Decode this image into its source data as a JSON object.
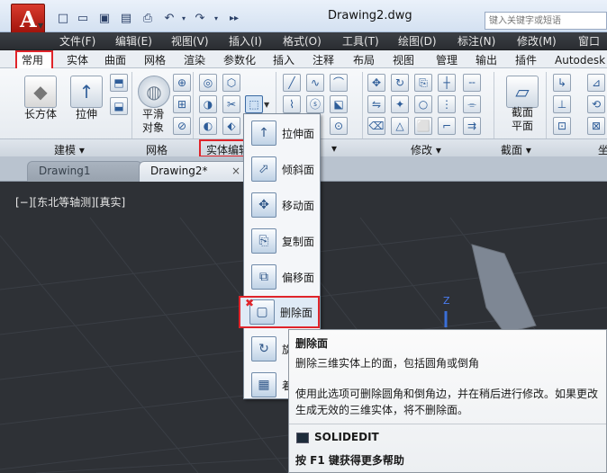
{
  "app": {
    "title": "Drawing2.dwg",
    "logo_letter": "A",
    "search_placeholder": "键入关键字或短语"
  },
  "quick_access": [
    "new-icon",
    "open-icon",
    "save-icon",
    "saveas-icon",
    "print-icon",
    "undo-icon",
    "redo-icon",
    "more-icon"
  ],
  "menu": [
    "文件(F)",
    "编辑(E)",
    "视图(V)",
    "插入(I)",
    "格式(O)",
    "工具(T)",
    "绘图(D)",
    "标注(N)",
    "修改(M)",
    "窗口"
  ],
  "tabs": [
    "常用",
    "实体",
    "曲面",
    "网格",
    "渲染",
    "参数化",
    "插入",
    "注释",
    "布局",
    "视图",
    "管理",
    "输出",
    "插件",
    "Autodesk"
  ],
  "ribbon": {
    "box_label": "长方体",
    "extrude_label": "拉伸",
    "smooth_label": "平滑\n对象",
    "section_label": "截面\n平面",
    "panels": [
      "建模 ▾",
      "网格",
      "实体编辑",
      "▾",
      "修改 ▾",
      "截面 ▾",
      "坐"
    ]
  },
  "doc_tabs": [
    "Drawing1",
    "Drawing2*"
  ],
  "doc_tab_close": "×",
  "viewport_label": "[−][东北等轴测][真实]",
  "axis_label": "Z",
  "dropdown": [
    {
      "label": "拉伸面",
      "icon": "extrude-face-icon"
    },
    {
      "label": "倾斜面",
      "icon": "taper-face-icon"
    },
    {
      "label": "移动面",
      "icon": "move-face-icon"
    },
    {
      "label": "复制面",
      "icon": "copy-face-icon"
    },
    {
      "label": "偏移面",
      "icon": "offset-face-icon"
    },
    {
      "label": "删除面",
      "icon": "delete-face-icon"
    },
    {
      "label": "旋",
      "icon": "rotate-face-icon"
    },
    {
      "label": "着",
      "icon": "color-face-icon"
    }
  ],
  "tooltip": {
    "title": "删除面",
    "desc": "删除三维实体上的面，包括圆角或倒角",
    "detail1": "使用此选项可删除圆角和倒角边，并在稍后进行修改。如果更改",
    "detail2": "生成无效的三维实体，将不删除面。",
    "command": "SOLIDEDIT",
    "help": "按 F1 键获得更多帮助"
  },
  "colors": {
    "highlight": "#e0242a",
    "accent": "#2e5d99"
  }
}
